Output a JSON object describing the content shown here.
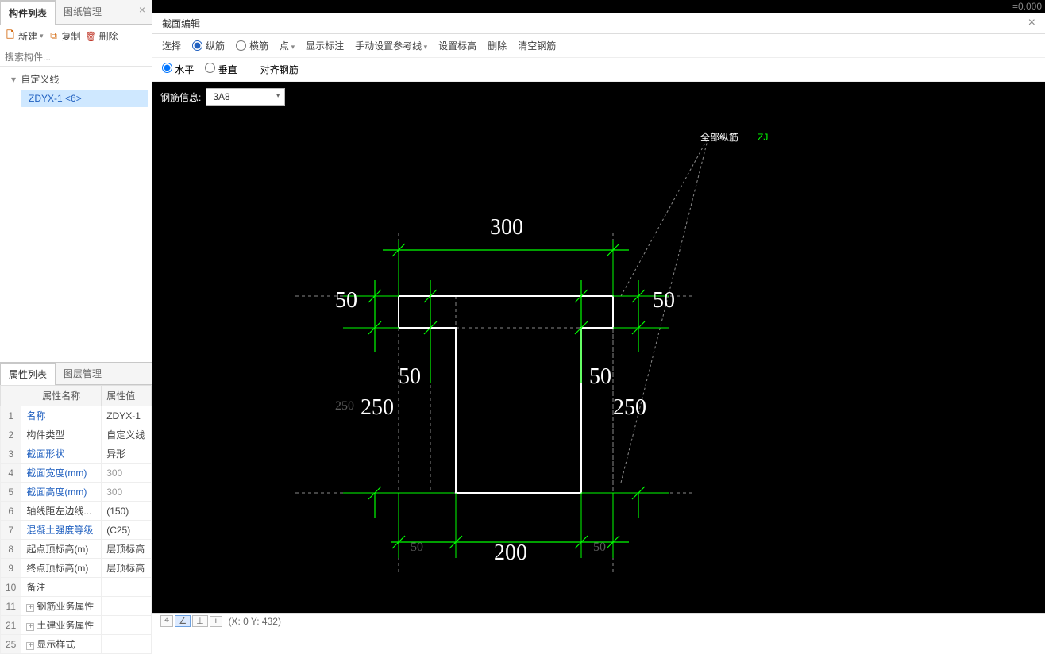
{
  "left_tabs": {
    "components": "构件列表",
    "drawings": "图纸管理"
  },
  "left_toolbar": {
    "new": "新建",
    "new_sfx": "▾",
    "copy": "复制",
    "delete": "删除"
  },
  "search_placeholder": "搜索构件...",
  "tree": {
    "root": "自定义线",
    "child": "ZDYX-1 <6>"
  },
  "prop_tabs": {
    "props": "属性列表",
    "layers": "图层管理"
  },
  "prop_headers": {
    "num": "",
    "name": "属性名称",
    "val": "属性值"
  },
  "properties": [
    {
      "num": "1",
      "name": "名称",
      "val": "ZDYX-1",
      "link": true
    },
    {
      "num": "2",
      "name": "构件类型",
      "val": "自定义线"
    },
    {
      "num": "3",
      "name": "截面形状",
      "val": "异形",
      "link": true
    },
    {
      "num": "4",
      "name": "截面宽度(mm)",
      "val": "300",
      "link": true,
      "gray": true
    },
    {
      "num": "5",
      "name": "截面高度(mm)",
      "val": "300",
      "link": true,
      "gray": true
    },
    {
      "num": "6",
      "name": "轴线距左边线...",
      "val": "(150)"
    },
    {
      "num": "7",
      "name": "混凝土强度等级",
      "val": "(C25)",
      "link": true
    },
    {
      "num": "8",
      "name": "起点顶标高(m)",
      "val": "层顶标高"
    },
    {
      "num": "9",
      "name": "终点顶标高(m)",
      "val": "层顶标高"
    },
    {
      "num": "10",
      "name": "备注",
      "val": ""
    },
    {
      "num": "11",
      "name": "钢筋业务属性",
      "val": "",
      "expand": true
    },
    {
      "num": "21",
      "name": "土建业务属性",
      "val": "",
      "expand": true
    },
    {
      "num": "25",
      "name": "显示样式",
      "val": "",
      "expand": true
    }
  ],
  "section_editor": {
    "title": "截面编辑",
    "row1": {
      "select": "选择",
      "longitudinal": "纵筋",
      "transverse": "横筋",
      "point": "点",
      "show_dim": "显示标注",
      "manual_ref": "手动设置参考线",
      "set_elev": "设置标高",
      "delete": "删除",
      "clear_rebar": "清空钢筋"
    },
    "row2": {
      "horizontal": "水平",
      "vertical": "垂直",
      "align_rebar": "对齐钢筋"
    },
    "rebar_info_label": "钢筋信息:",
    "rebar_info_value": "3A8"
  },
  "drawing": {
    "title_all": "全部纵筋",
    "title_code": "ZJ",
    "dim_top": "300",
    "dim_bottom": "200",
    "dim_50": "50",
    "dim_250": "250",
    "ref250": "250"
  },
  "status": {
    "coord": "(X: 0 Y: 432)",
    "topright": "=0.000"
  }
}
